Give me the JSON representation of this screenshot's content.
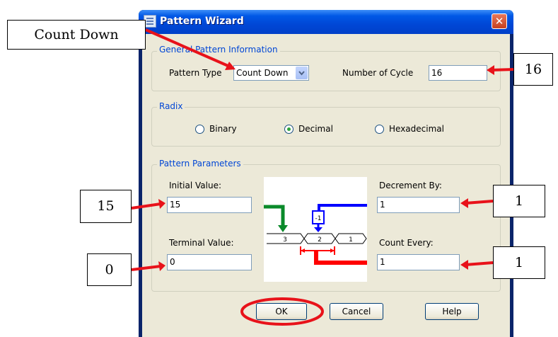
{
  "window": {
    "title": "Pattern Wizard"
  },
  "general": {
    "group_label": "General Pattern Information",
    "pattern_type_label": "Pattern Type",
    "pattern_type_value": "Count Down",
    "number_of_cycle_label": "Number of Cycle",
    "number_of_cycle_value": "16"
  },
  "radix": {
    "group_label": "Radix",
    "options": [
      "Binary",
      "Decimal",
      "Hexadecimal"
    ],
    "selected": "Decimal"
  },
  "params": {
    "group_label": "Pattern Parameters",
    "initial_label": "Initial Value:",
    "initial_value": "15",
    "terminal_label": "Terminal Value:",
    "terminal_value": "0",
    "decrement_label": "Decrement By:",
    "decrement_value": "1",
    "count_every_label": "Count Every:",
    "count_every_value": "1",
    "diagram": {
      "step_label": "-1",
      "values": [
        "3",
        "2",
        "1"
      ]
    }
  },
  "buttons": {
    "ok": "OK",
    "cancel": "Cancel",
    "help": "Help"
  },
  "callouts": {
    "pattern_type": "Count Down",
    "cycles": "16",
    "initial": "15",
    "terminal": "0",
    "decrement": "1",
    "count_every": "1"
  },
  "colors": {
    "annotation": "#e8121a",
    "titlebar": "#0050d8",
    "group_label": "#0046d5",
    "diagram_blue": "#0000ff",
    "diagram_green": "#0a8a2a",
    "diagram_red": "#ff0000"
  }
}
